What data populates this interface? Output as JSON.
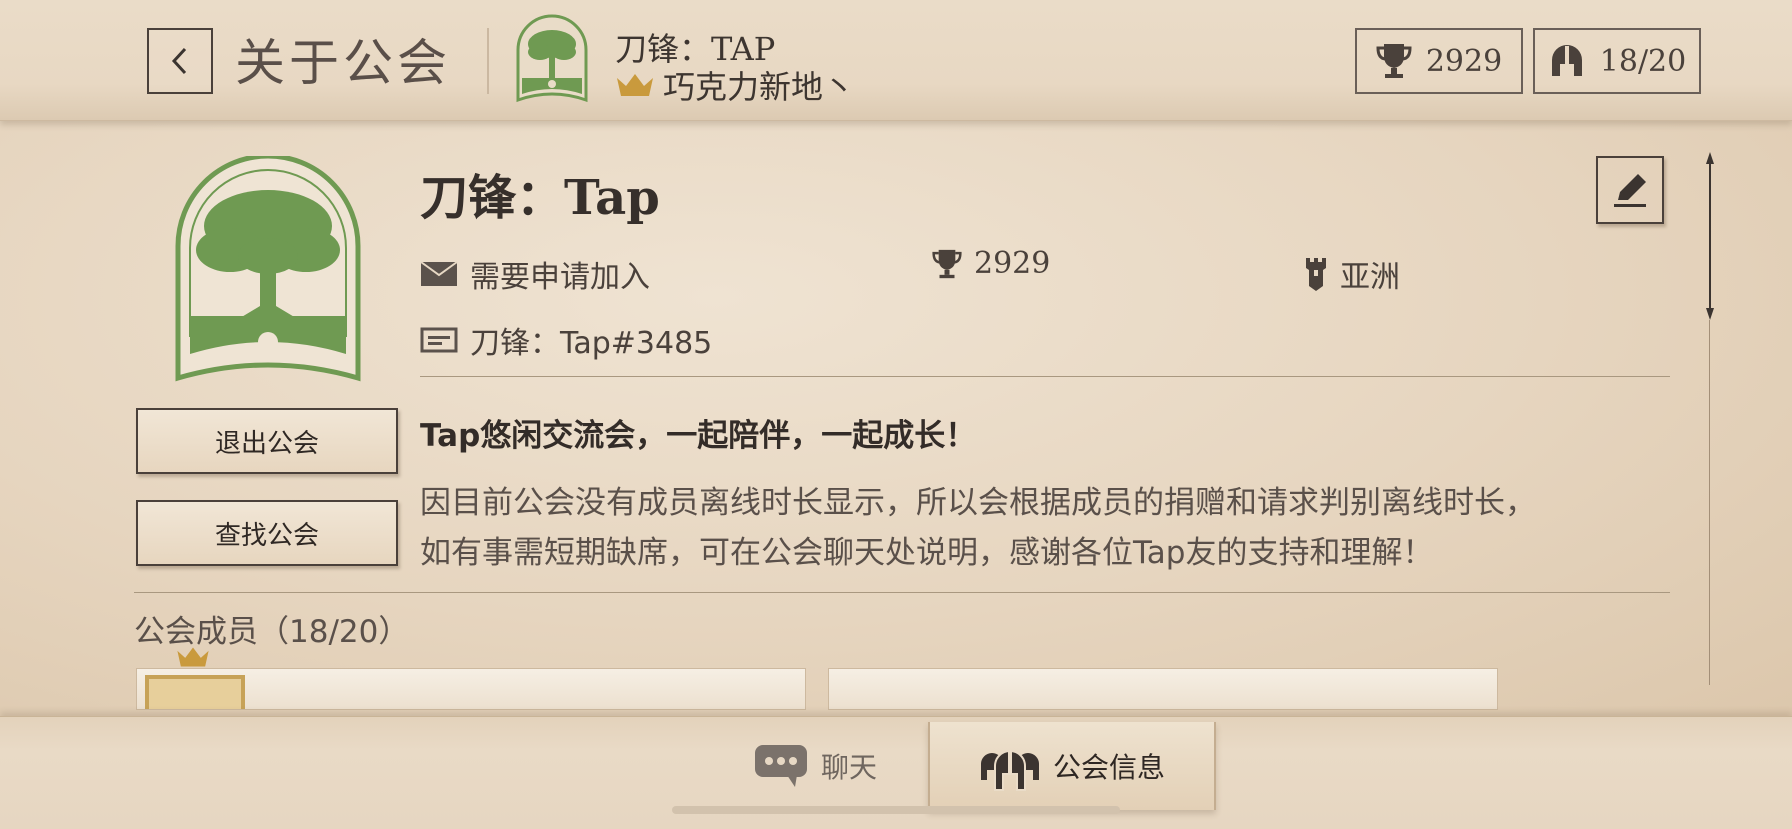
{
  "header": {
    "title": "关于公会",
    "guild_name": "刀锋：TAP",
    "owner_name": "巧克力新地丶",
    "trophies": "2929",
    "members": "18/20"
  },
  "guild": {
    "name": "刀锋：Tap",
    "join_type": "需要申请加入",
    "trophies": "2929",
    "region": "亚洲",
    "tag": "刀锋：Tap#3485",
    "motto": "Tap悠闲交流会，一起陪伴，一起成长！",
    "description_line1": "因目前公会没有成员离线时长显示，所以会根据成员的捐赠和请求判别离线时长，",
    "description_line2": "如有事需短期缺席，可在公会聊天处说明，感谢各位Tap友的支持和理解！"
  },
  "buttons": {
    "leave": "退出公会",
    "find": "查找公会"
  },
  "members_section": {
    "label": "公会成员（18/20）"
  },
  "tabs": {
    "chat": "聊天",
    "info": "公会信息"
  },
  "colors": {
    "emblem_green": "#6f9a52",
    "gold": "#c99a3d",
    "ink": "#3b3430"
  }
}
